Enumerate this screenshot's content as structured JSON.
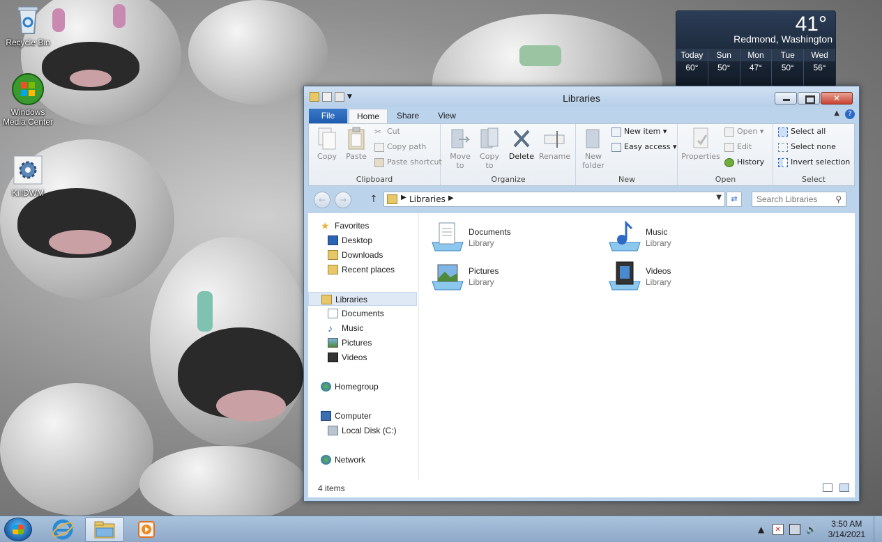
{
  "desktop": {
    "icons": [
      {
        "label": "Recycle Bin"
      },
      {
        "label": "Windows Media Center"
      },
      {
        "label": "KillDWM"
      }
    ]
  },
  "weather": {
    "temperature": "41°",
    "location": "Redmond, Washington",
    "forecast": [
      {
        "day": "Today",
        "temp": "60°"
      },
      {
        "day": "Sun",
        "temp": "50°"
      },
      {
        "day": "Mon",
        "temp": "47°"
      },
      {
        "day": "Tue",
        "temp": "50°"
      },
      {
        "day": "Wed",
        "temp": "56°"
      }
    ]
  },
  "window": {
    "title": "Libraries",
    "tabs": {
      "file": "File",
      "home": "Home",
      "share": "Share",
      "view": "View"
    },
    "help": "?",
    "ribbon": {
      "clipboard": {
        "name": "Clipboard",
        "copy": "Copy",
        "paste": "Paste",
        "cut": "Cut",
        "copy_path": "Copy path",
        "paste_shortcut": "Paste shortcut"
      },
      "organize": {
        "name": "Organize",
        "move_to": "Move to",
        "copy_to": "Copy to",
        "delete": "Delete",
        "rename": "Rename"
      },
      "new": {
        "name": "New",
        "new_folder": "New folder",
        "new_item": "New item ▾",
        "easy_access": "Easy access ▾"
      },
      "open": {
        "name": "Open",
        "properties": "Properties",
        "open": "Open ▾",
        "edit": "Edit",
        "history": "History"
      },
      "select": {
        "name": "Select",
        "select_all": "Select all",
        "select_none": "Select none",
        "invert_selection": "Invert selection"
      }
    },
    "address": {
      "crumb": "Libraries",
      "search_placeholder": "Search Libraries"
    },
    "nav": {
      "favorites": "Favorites",
      "desktop": "Desktop",
      "downloads": "Downloads",
      "recent": "Recent places",
      "libraries": "Libraries",
      "documents": "Documents",
      "music": "Music",
      "pictures": "Pictures",
      "videos": "Videos",
      "homegroup": "Homegroup",
      "computer": "Computer",
      "local_disk": "Local Disk (C:)",
      "network": "Network"
    },
    "items": [
      {
        "name": "Documents",
        "type": "Library"
      },
      {
        "name": "Music",
        "type": "Library"
      },
      {
        "name": "Pictures",
        "type": "Library"
      },
      {
        "name": "Videos",
        "type": "Library"
      }
    ],
    "status": {
      "count": "4 items"
    }
  },
  "taskbar": {
    "clock_time": "3:50 AM",
    "clock_date": "3/14/2021",
    "tray_chevron": "▲"
  },
  "colors": {
    "accent": "#1d5cb0",
    "close": "#c74333"
  }
}
